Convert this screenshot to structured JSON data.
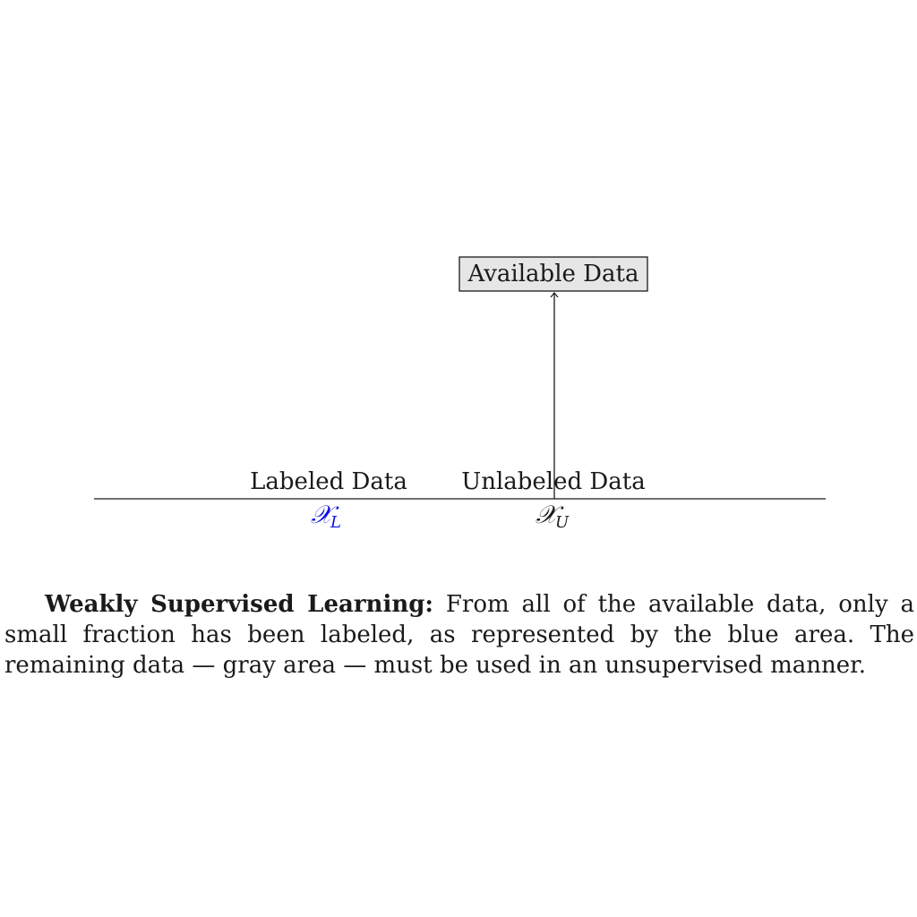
{
  "diagram": {
    "top_box_label": "Available Data",
    "labeled_label": "Labeled Data",
    "unlabeled_label": "Unlabeled Data",
    "labeled_symbol": "𝒳",
    "labeled_subscript": "L",
    "unlabeled_symbol": "𝒳",
    "unlabeled_subscript": "U",
    "labeled_color": "#1010e0",
    "unlabeled_color": "#1a1a1a",
    "box_fill": "#e6e6e6"
  },
  "caption": {
    "lead": "Weakly Supervised Learning:",
    "body": "From all of the available data, only a small fraction has been labeled, as represented by the blue area. The remaining data — gray area — must be used in an unsupervised manner."
  }
}
